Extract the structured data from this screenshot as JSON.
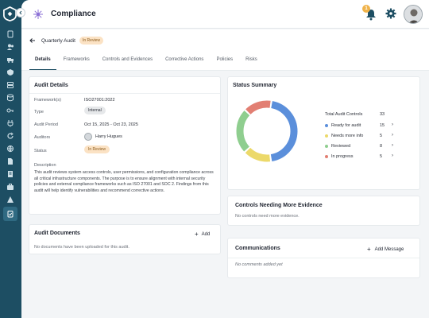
{
  "app": {
    "title": "Compliance",
    "notification_count": "1"
  },
  "breadcrumb": {
    "title": "Quarterly Audit",
    "status": "In Review"
  },
  "tabs": [
    {
      "label": "Details"
    },
    {
      "label": "Frameworks"
    },
    {
      "label": "Controls and Evidences"
    },
    {
      "label": "Corrective Actions"
    },
    {
      "label": "Policies"
    },
    {
      "label": "Risks"
    }
  ],
  "audit_details": {
    "title": "Audit Details",
    "framework_label": "Framework(s)",
    "framework_value": "ISO27001:2022",
    "type_label": "Type",
    "type_value": "Internal",
    "period_label": "Audit Period",
    "period_value": "Oct 15, 2025 - Oct 23, 2025",
    "auditors_label": "Auditors",
    "auditor_name": "Harry Hugues",
    "status_label": "Status",
    "status_value": "In Review",
    "description_label": "Description",
    "description_text": "This audit reviews system access controls, user permissions, and configuration compliance across all critical infrastructure components. The purpose is to ensure alignment with internal security policies and external compliance frameworks such as ISO 27001 and SOC 2. Findings from this audit will help identify vulnerabilities and recommend corrective actions."
  },
  "audit_documents": {
    "title": "Audit Documents",
    "add_label": "Add",
    "empty_text": "No documents have been uploaded for this audit."
  },
  "status_summary": {
    "title": "Status Summary",
    "total_label": "Total Audit Controls",
    "total_value": "33",
    "items": [
      {
        "label": "Ready for audit",
        "value": "15",
        "color": "#5b8fdb"
      },
      {
        "label": "Needs more info",
        "value": "5",
        "color": "#ecd96a"
      },
      {
        "label": "Reviewed",
        "value": "8",
        "color": "#8fce8f"
      },
      {
        "label": "In progress",
        "value": "5",
        "color": "#e27f73"
      }
    ]
  },
  "evidence": {
    "title": "Controls Needing More Evidence",
    "empty_text": "No controls need more evidence."
  },
  "communications": {
    "title": "Communications",
    "add_label": "Add Message",
    "empty_text": "No comments added yet"
  },
  "colors": {
    "sidebar": "#1d4e63",
    "accent": "#1d4e63",
    "review_badge": "#fbe2c4"
  }
}
